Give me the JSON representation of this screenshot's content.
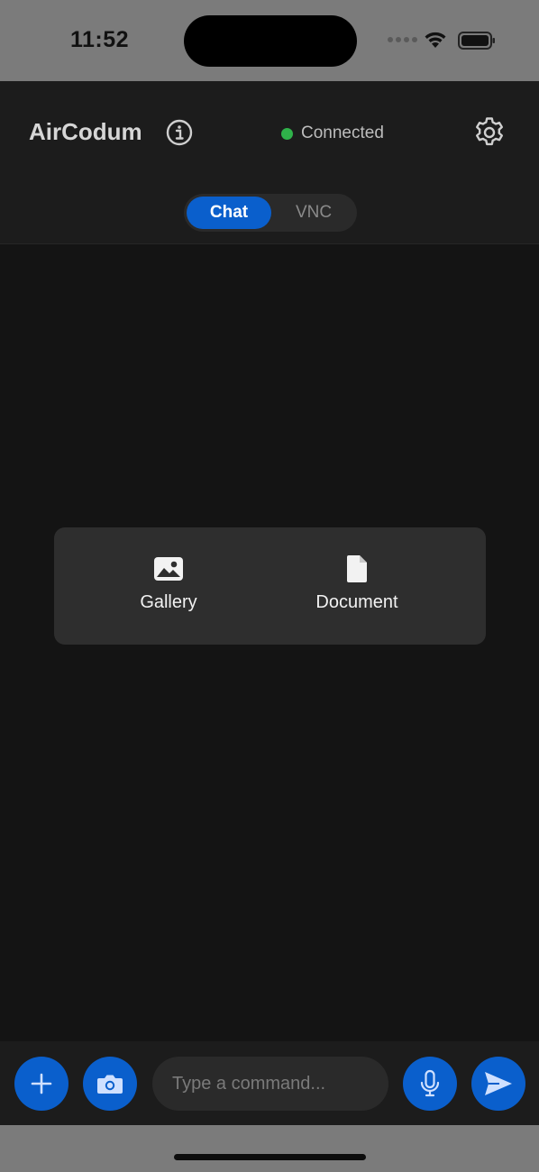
{
  "status_bar": {
    "time": "11:52"
  },
  "header": {
    "app_title": "AirCodum",
    "connection_status": "Connected",
    "connection_color": "#2fb24a",
    "info_icon": "info-icon",
    "settings_icon": "gear-icon"
  },
  "tabs": {
    "items": [
      {
        "label": "Chat",
        "active": true
      },
      {
        "label": "VNC",
        "active": false
      }
    ],
    "accent": "#0a5fcc"
  },
  "attach_menu": {
    "items": [
      {
        "label": "Gallery",
        "icon": "image-icon"
      },
      {
        "label": "Document",
        "icon": "document-icon"
      }
    ]
  },
  "composer": {
    "placeholder": "Type a command...",
    "value": "",
    "buttons": [
      {
        "icon": "plus-icon"
      },
      {
        "icon": "camera-icon"
      },
      {
        "icon": "microphone-icon"
      },
      {
        "icon": "send-icon"
      }
    ]
  }
}
